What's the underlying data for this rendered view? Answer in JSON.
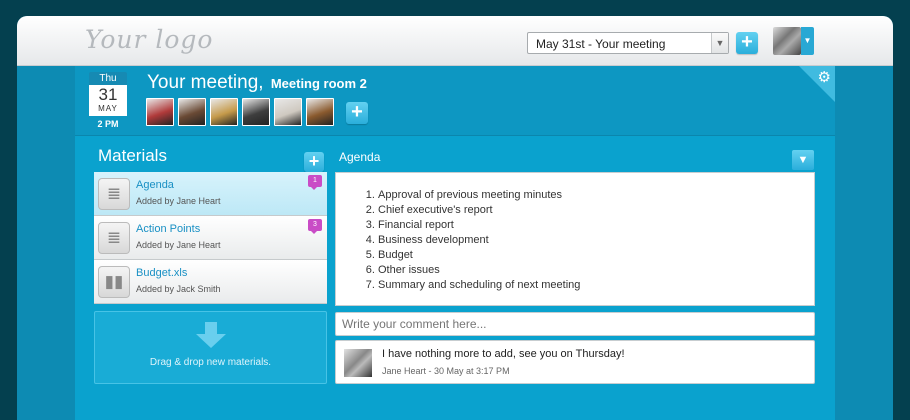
{
  "header": {
    "logo": "Your logo",
    "meeting_select": "May 31st - Your meeting",
    "add_label": "+"
  },
  "meeting": {
    "day_name": "Thu",
    "day": "31",
    "month": "MAY",
    "time": "2 PM",
    "title": "Your meeting,",
    "room": "Meeting room 2",
    "add_attendee_label": "+"
  },
  "attendees": [
    {
      "color": "#b03a3a"
    },
    {
      "color": "#6a4a35"
    },
    {
      "color": "#c59a4a"
    },
    {
      "color": "#3e3e3e"
    },
    {
      "color": "#cfc9c0"
    },
    {
      "color": "#8a5a2e"
    }
  ],
  "materials": {
    "title": "Materials",
    "add_label": "+",
    "items": [
      {
        "name": "Agenda",
        "added_by": "Added by Jane Heart",
        "badge": "1",
        "icon": "document-icon"
      },
      {
        "name": "Action Points",
        "added_by": "Added by Jane Heart",
        "badge": "3",
        "icon": "document-icon"
      },
      {
        "name": "Budget.xls",
        "added_by": "Added by Jack Smith",
        "badge": "",
        "icon": "chart-icon"
      }
    ],
    "dropzone_text": "Drag & drop new materials."
  },
  "agenda": {
    "title": "Agenda",
    "items": [
      "Approval of previous meeting minutes",
      "Chief executive's report",
      "Financial report",
      "Business development",
      "Budget",
      "Other issues",
      "Summary and scheduling of next meeting"
    ]
  },
  "comments": {
    "placeholder": "Write your comment here...",
    "items": [
      {
        "text": "I have nothing more to add, see you on Thursday!",
        "meta": "Jane Heart - 30 May at 3:17 PM"
      }
    ]
  }
}
